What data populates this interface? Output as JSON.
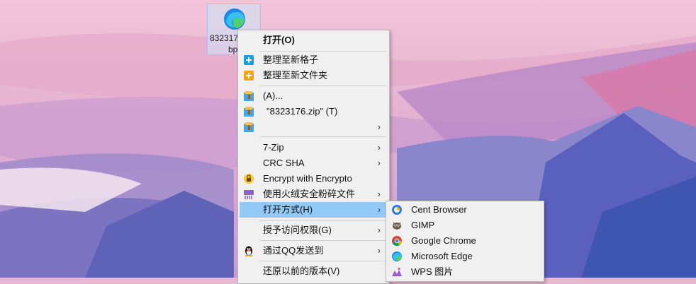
{
  "desktop": {
    "icon_label_line1": "832317",
    "icon_label_line2": "bp"
  },
  "context_menu": {
    "open": "打开(O)",
    "organize_new_grid": "整理至新格子",
    "organize_new_folder": "整理至新文件夹",
    "archive_add": "(A)...",
    "archive_zip": "\"8323176.zip\" (T)",
    "archive_more": "",
    "seven_zip": "7-Zip",
    "crc_sha": "CRC SHA",
    "encrypto": "Encrypt with Encrypto",
    "shred": "使用火绒安全粉碎文件",
    "open_with": "打开方式(H)",
    "grant_access": "授予访问权限(G)",
    "send_qq": "通过QQ发送到",
    "restore_versions": "还原以前的版本(V)",
    "arrow": "›"
  },
  "open_with_submenu": {
    "items": [
      "Cent Browser",
      "GIMP",
      "Google Chrome",
      "Microsoft Edge",
      "WPS 图片"
    ]
  }
}
